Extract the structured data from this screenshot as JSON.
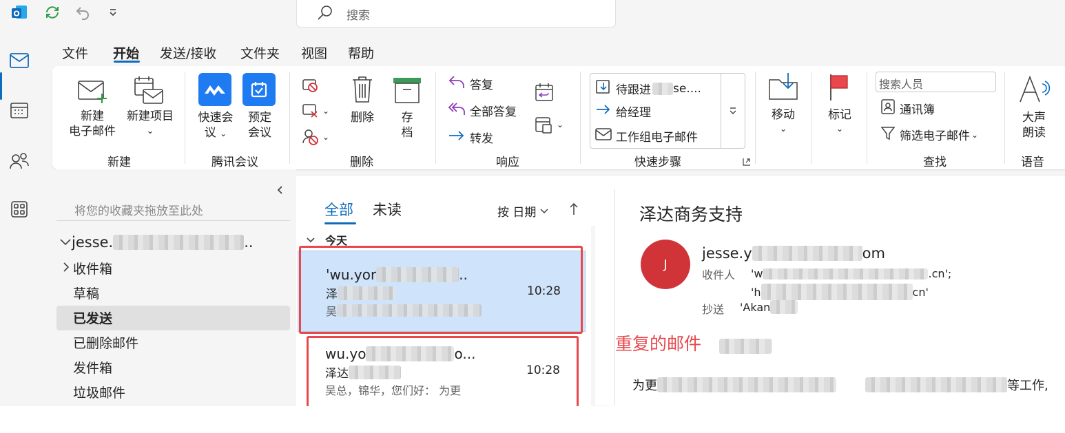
{
  "titlebar": {
    "search_placeholder": "搜索",
    "icons": [
      "outlook-logo-icon",
      "sync-icon",
      "undo-icon",
      "customize-icon"
    ]
  },
  "menu": {
    "tabs": [
      "文件",
      "开始",
      "发送/接收",
      "文件夹",
      "视图",
      "帮助"
    ],
    "active": "开始"
  },
  "ribbon": {
    "new_mail_line1": "新建",
    "new_mail_line2": "电子邮件",
    "new_item": "新建项目",
    "group_new": "新建",
    "quick_meeting_line1": "快速会",
    "quick_meeting_line2": "议",
    "schedule_meeting_line1": "预定",
    "schedule_meeting_line2": "会议",
    "group_tencent": "腾讯会议",
    "delete": "删除",
    "archive_line1": "存",
    "archive_line2": "档",
    "group_delete": "删除",
    "reply": "答复",
    "reply_all": "全部答复",
    "forward": "转发",
    "group_respond": "响应",
    "qs_followup": "待跟进",
    "qs_followup_suffix": "se....",
    "qs_manager": "给经理",
    "qs_team": "工作组电子邮件",
    "group_quicksteps": "快速步骤",
    "move": "移动",
    "flag": "标记",
    "search_people_placeholder": "搜索人员",
    "address_book": "通讯簿",
    "filter_mail": "筛选电子邮件",
    "group_find": "查找",
    "read_aloud_line1": "大声",
    "read_aloud_line2": "朗读",
    "group_voice": "语音"
  },
  "folders": {
    "drop_hint": "将您的收藏夹拖放至此处",
    "account": "jesse.",
    "account_suffix": "..",
    "items": [
      "收件箱",
      "草稿",
      "已发送",
      "已删除邮件",
      "发件箱",
      "垃圾邮件"
    ],
    "selected": "已发送"
  },
  "message_list": {
    "tab_all": "全部",
    "tab_unread": "未读",
    "sort_label": "按 日期",
    "group_today": "今天",
    "messages": [
      {
        "to": "'wu.yor",
        "to_suffix": "..",
        "subject": "泽",
        "time": "10:28",
        "preview": "吴"
      },
      {
        "to": "wu.yo",
        "to_suffix": "o...",
        "subject": "泽达",
        "time": "10:28",
        "preview": "吴总，锦华，您们好：  为更"
      }
    ]
  },
  "reading": {
    "title": "泽达商务支持",
    "avatar_letter": "J",
    "sender": "jesse.y",
    "sender_suffix": "om",
    "to_label": "收件人",
    "to_line1": "'w",
    "to_line1_suffix": ".cn';",
    "to_line2": "'h",
    "to_line2_suffix": "cn'",
    "cc_label": "抄送",
    "cc_value": "'Akan",
    "body_start": "为更",
    "body_end": "等工作,"
  },
  "annotation": {
    "text": "重复的邮件"
  },
  "colors": {
    "accent": "#0f6cbd",
    "selected_message": "#cfe4fa",
    "annotation_red": "#e8474c",
    "avatar": "#d13438",
    "flag_red": "#e8474c"
  }
}
